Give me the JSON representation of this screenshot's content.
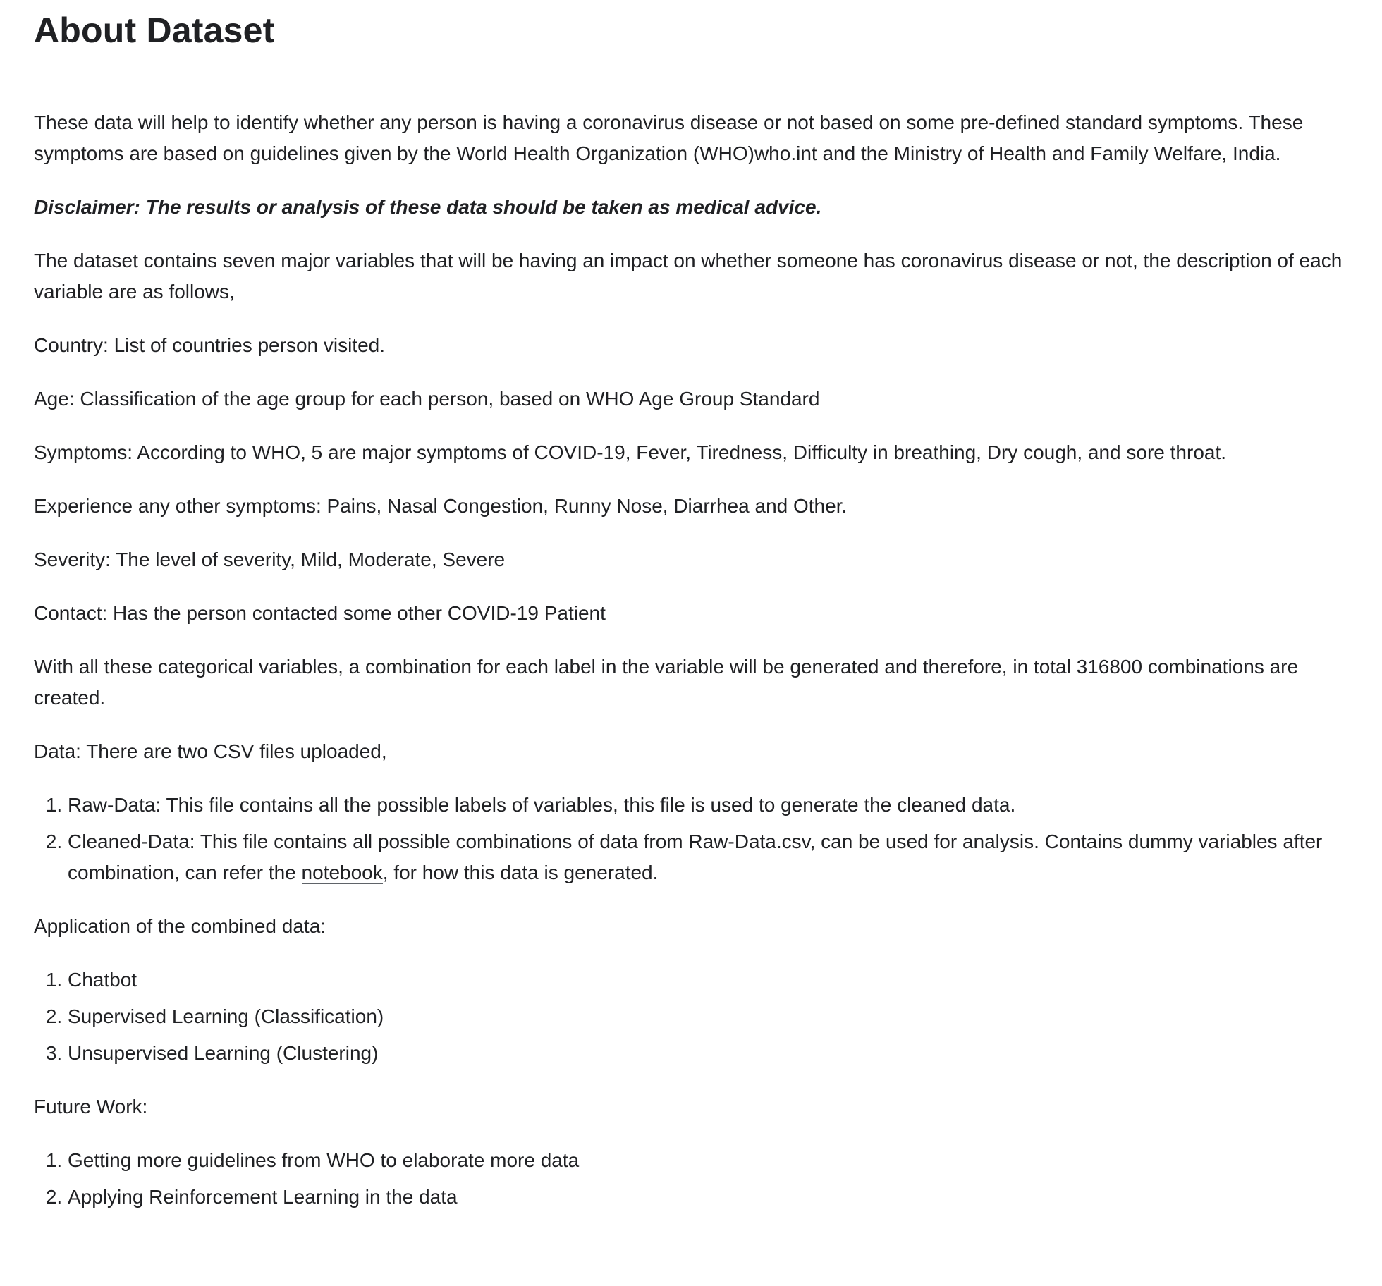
{
  "title": "About Dataset",
  "intro": "These data will help to identify whether any person is having a coronavirus disease or not based on some pre-defined standard symptoms. These symptoms are based on guidelines given by the World Health Organization (WHO)who.int and the Ministry of Health and Family Welfare, India.",
  "disclaimer": "Disclaimer: The results or analysis of these data should be taken as medical advice.",
  "dataset_intro": "The dataset contains seven major variables that will be having an impact on whether someone has coronavirus disease or not, the description of each variable are as follows,",
  "variables": {
    "country": "Country: List of countries person visited.",
    "age": "Age: Classification of the age group for each person, based on WHO Age Group Standard",
    "symptoms": "Symptoms: According to WHO, 5 are major symptoms of COVID-19, Fever, Tiredness, Difficulty in breathing, Dry cough, and sore throat.",
    "other_symptoms": "Experience any other symptoms: Pains, Nasal Congestion, Runny Nose, Diarrhea and Other.",
    "severity": "Severity: The level of severity, Mild, Moderate, Severe",
    "contact": "Contact: Has the person contacted some other COVID-19 Patient"
  },
  "combinations": "With all these categorical variables, a combination for each label in the variable will be generated and therefore, in total 316800 combinations are created.",
  "data_heading": "Data: There are two CSV files uploaded,",
  "data_files": {
    "raw": "Raw-Data: This file contains all the possible labels of variables, this file is used to generate the cleaned data.",
    "cleaned_before": "Cleaned-Data: This file contains all possible combinations of data from Raw-Data.csv, can be used for analysis. Contains dummy variables after combination, can refer the ",
    "cleaned_link": "notebook",
    "cleaned_after": ", for how this data is generated."
  },
  "application_heading": "Application of the combined data:",
  "applications": [
    "Chatbot",
    "Supervised Learning (Classification)",
    "Unsupervised Learning (Clustering)"
  ],
  "future_heading": "Future Work:",
  "future_work": [
    "Getting more guidelines from WHO to elaborate more data",
    "Applying Reinforcement Learning in the data"
  ]
}
